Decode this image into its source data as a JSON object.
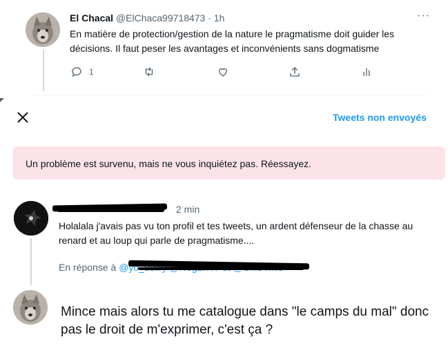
{
  "top_tweet": {
    "display_name": "El Chacal",
    "handle_time": "@ElChaca99718473 · 1h",
    "more": "···",
    "text": "En matière de protection/gestion de la nature le pragmatisme doit guider les décisions. Il faut peser les avantages et inconvénients sans dogmatisme",
    "actions": {
      "reply_count": "1",
      "reply_icon": "reply-icon",
      "retweet_icon": "retweet-icon",
      "like_icon": "heart-icon",
      "share_icon": "share-icon",
      "analytics_icon": "analytics-icon"
    }
  },
  "composer": {
    "close_icon": "close-icon",
    "unsent_label": "Tweets non envoyés",
    "error_message": "Un problème est survenu, mais ne vous inquiétez pas. Réessayez.",
    "error_bg": "#fce3e8",
    "accent": "#1d9bf0"
  },
  "reply_tweet": {
    "time": "2 min",
    "text": "Holalala j'avais pas vu ton profil et tes tweets, un ardent défenseur de la chasse au renard et au loup qui parle de pragmatisme....",
    "reply_to_label": "En réponse à",
    "reply_to_handles": "@yo_dowy @RegBrXV et @Chl3 Mlle"
  },
  "draft": {
    "text": "Mince mais alors tu me catalogue dans \"le camps du mal\" donc pas le droit de m'exprimer, c'est ça ?"
  }
}
